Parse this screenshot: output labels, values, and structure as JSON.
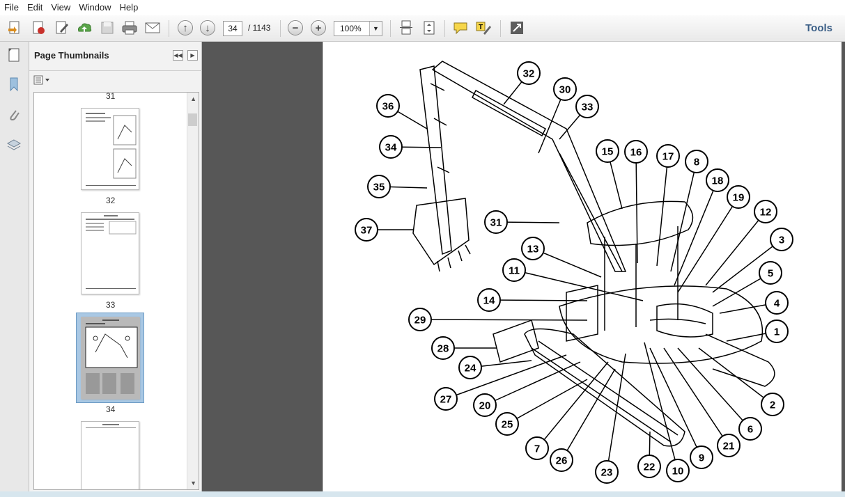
{
  "menubar": {
    "items": [
      "File",
      "Edit",
      "View",
      "Window",
      "Help"
    ]
  },
  "toolbar": {
    "current_page": "34",
    "total_pages": "/ 1143",
    "zoom": "100%",
    "tools_label": "Tools"
  },
  "icons": {
    "toolbar": [
      "create-pdf-icon",
      "stamp-icon",
      "edit-icon",
      "upload-icon",
      "save-icon",
      "print-icon",
      "email-icon",
      "previous-page-icon",
      "next-page-icon",
      "zoom-out-icon",
      "zoom-in-icon",
      "scrolling-mode-icon",
      "fit-page-icon",
      "comment-icon",
      "highlight-text-icon",
      "expand-icon"
    ],
    "rail": [
      "page-thumbnails-icon",
      "bookmark-icon",
      "attachment-icon",
      "layers-icon"
    ]
  },
  "panel": {
    "title": "Page Thumbnails",
    "thumbnail_labels": [
      "31",
      "32",
      "33",
      "34"
    ]
  },
  "diagram": {
    "callouts": [
      "32",
      "30",
      "33",
      "36",
      "34",
      "35",
      "37",
      "31",
      "15",
      "16",
      "17",
      "8",
      "18",
      "19",
      "12",
      "3",
      "13",
      "11",
      "14",
      "5",
      "4",
      "29",
      "1",
      "28",
      "24",
      "27",
      "20",
      "25",
      "7",
      "26",
      "23",
      "22",
      "10",
      "9",
      "21",
      "6",
      "2"
    ]
  },
  "colors": {
    "toolbar_accent": "#3a5e86",
    "doc_background": "#575757",
    "thumb_selection": "#a9c8e4"
  }
}
